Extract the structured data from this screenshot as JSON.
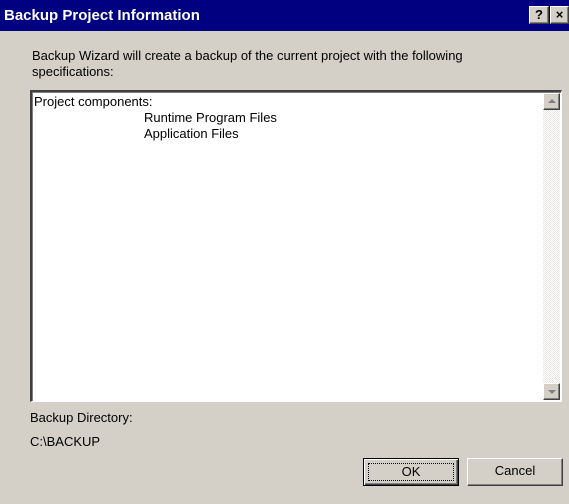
{
  "window": {
    "title": "Backup Project Information",
    "help_glyph": "?",
    "close_glyph": "×"
  },
  "intro_text": "Backup Wizard will create a backup of the current project with the following specifications:",
  "details": {
    "heading": "Project components:",
    "items": [
      "Runtime Program Files",
      "Application Files"
    ]
  },
  "backup": {
    "label": "Backup Directory:",
    "path": "C:\\BACKUP"
  },
  "buttons": {
    "ok": "OK",
    "cancel": "Cancel"
  }
}
